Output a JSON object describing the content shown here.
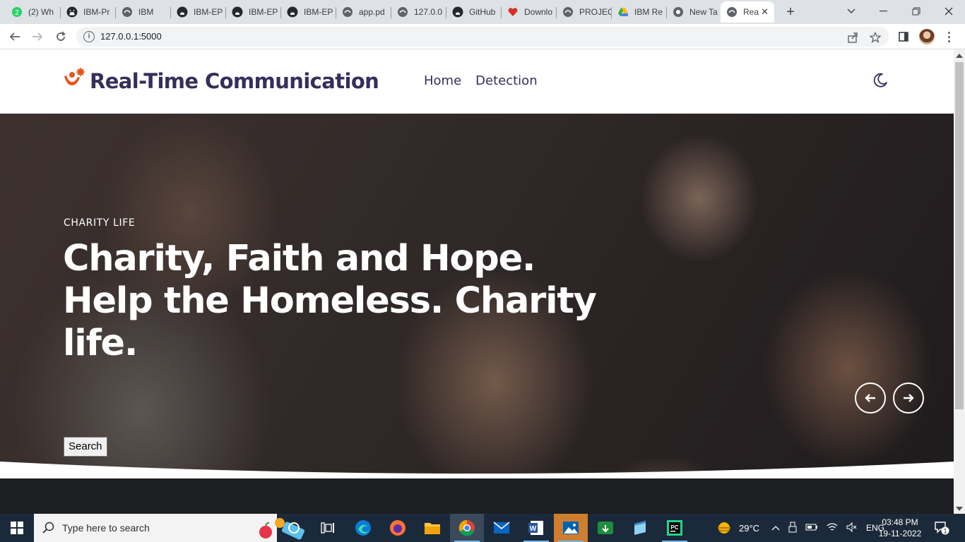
{
  "browser": {
    "tabs": [
      {
        "label": "(2) Wh",
        "icon": "whatsapp-icon"
      },
      {
        "label": "IBM-Pr",
        "icon": "github-icon"
      },
      {
        "label": "IBM",
        "icon": "globe-icon"
      },
      {
        "label": "IBM-EP",
        "icon": "github-icon"
      },
      {
        "label": "IBM-EP",
        "icon": "github-icon"
      },
      {
        "label": "IBM-EP",
        "icon": "github-icon"
      },
      {
        "label": "app.pd",
        "icon": "globe-icon"
      },
      {
        "label": "127.0.0",
        "icon": "globe-icon"
      },
      {
        "label": "GitHub",
        "icon": "github-icon"
      },
      {
        "label": "Downlo",
        "icon": "heart-icon"
      },
      {
        "label": "PROJEC",
        "icon": "globe-icon"
      },
      {
        "label": "IBM Re",
        "icon": "drive-icon"
      },
      {
        "label": "New Ta",
        "icon": "chrome-icon"
      },
      {
        "label": "Rea",
        "icon": "globe-icon"
      }
    ],
    "whatsapp_badge": "2",
    "url": "127.0.0.1:5000"
  },
  "site": {
    "brand": "Real-Time Communication",
    "nav": [
      "Home",
      "Detection"
    ],
    "hero": {
      "eyebrow": "CHARITY LIFE",
      "title": "Charity, Faith and Hope. Help the Homeless. Charity life.",
      "search_label": "Search"
    }
  },
  "taskbar": {
    "search_placeholder": "Type here to search",
    "weather": "29°C",
    "language": "ENG",
    "time": "03:48 PM",
    "date": "19-11-2022",
    "notification_count": "1"
  },
  "colors": {
    "brand_text": "#352f5b",
    "brand_icon": "#e8541e",
    "taskbar_bg": "#1b2a3a",
    "dark_band": "#1d1e22"
  }
}
